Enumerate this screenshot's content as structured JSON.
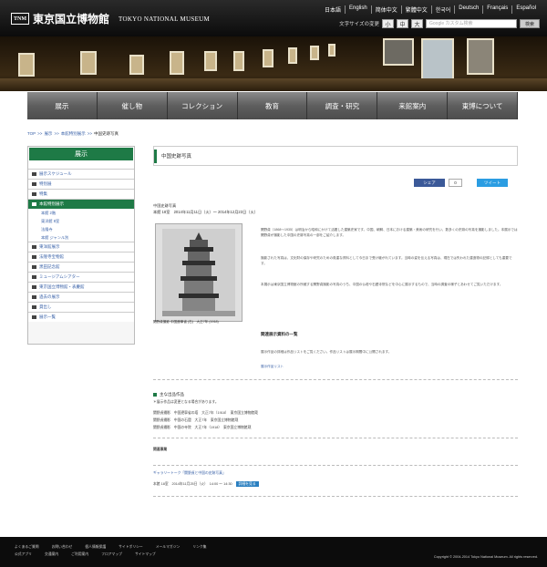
{
  "header": {
    "logo_mark": "TNM",
    "site_name_jp": "東京国立博物館",
    "site_name_en": "TOKYO NATIONAL MUSEUM",
    "languages": [
      "日本語",
      "English",
      "简体中文",
      "繁體中文",
      "한국어",
      "Deutsch",
      "Français",
      "Español"
    ],
    "text_size_label": "文字サイズの変更",
    "size_buttons": [
      "小",
      "中",
      "大"
    ],
    "search_placeholder": "Google カスタム検索",
    "search_button": "検索"
  },
  "nav": [
    "展示",
    "催し物",
    "コレクション",
    "教育",
    "調査・研究",
    "来館案内",
    "東博について"
  ],
  "breadcrumb": [
    "TOP",
    "展示",
    "本館特別展示",
    "中国史跡写真"
  ],
  "sidebar": {
    "heading": "展示",
    "items": [
      "展示スケジュール",
      "特別展",
      "特集",
      "本館特別展示",
      "東洋館展示",
      "法隆寺宝物館",
      "黒田記念館",
      "ミュージアムシアター",
      "東京国立博物館・表慶館",
      "過去の展示",
      "貸出し",
      "展示一覧"
    ],
    "subitems": [
      "本館 2階",
      "東洋館 8室",
      "法隆寺",
      "本館 ジャンル別"
    ]
  },
  "main": {
    "title": "中国史跡写真",
    "fb_label": "シェア",
    "fb_count": "0",
    "tw_label": "ツイート",
    "meta_line1": "中国史跡写真",
    "meta_line2": "本館 18室　2014年11月11日（火）～ 2014年12月23日（火）",
    "caption": "関野貞撮影 中国遼寧省 (右)　大正7年 (1918)",
    "para1": "関野貞（1868～1935）は明治から昭和にかけて活躍した建築史家です。中国、朝鮮、日本における建築・美術の研究を行い、数多くの史跡の写真を撮影しました。本展示では関野貞が撮影した中国の史跡写真の一部をご紹介します。",
    "para2": "撮影された写真は、文化財の保存や研究のための貴重な資料として今日まで受け継がれています。当時の姿を伝える写真は、現在では失われた建造物の記録としても重要です。",
    "para3": "本展示は東京国立博物館の所蔵する関野貞撮影の写真のうち、中国の仏塔や石窟寺院などを中心に展示するもので、当時の調査の様子とあわせてご覧いただけます。",
    "section_title": "関連展示資料の一覧",
    "section_desc": "展示作品の詳細は作品リストをご覧ください。作品リストは展示期間中に公開されます。",
    "list_link": "展示作品リスト",
    "h2": "主な出品作品",
    "h2_note": "＊展示作品は変更となる場合があります。",
    "works": [
      "関野貞撮影　中国遼寧省の塔　大正7年（1918）　東京国立博物館蔵",
      "関野貞撮影　中国の石窟　大正7年　東京国立博物館蔵",
      "関野貞撮影　中国の寺院　大正7年（1918）　東京国立博物館蔵"
    ],
    "related_title": "関連事業",
    "event_line": "ギャラリートーク「関野貞と中国の史跡写真」",
    "event_time": "本館 18室　2014年11月25日（火）　14:00 ～ 14:30",
    "event_badge": "詳細を見る"
  },
  "footer": {
    "row1": [
      "よくあるご質問",
      "お問い合わせ",
      "個人情報保護",
      "サイトポリシー",
      "メールマガジン",
      "リンク集"
    ],
    "row2": [
      "公式アプリ",
      "交通案内",
      "ご利用案内",
      "フロアマップ",
      "サイトマップ"
    ],
    "copyright": "Copyright © 2004-2014 Tokyo National Museum. All rights reserved."
  }
}
